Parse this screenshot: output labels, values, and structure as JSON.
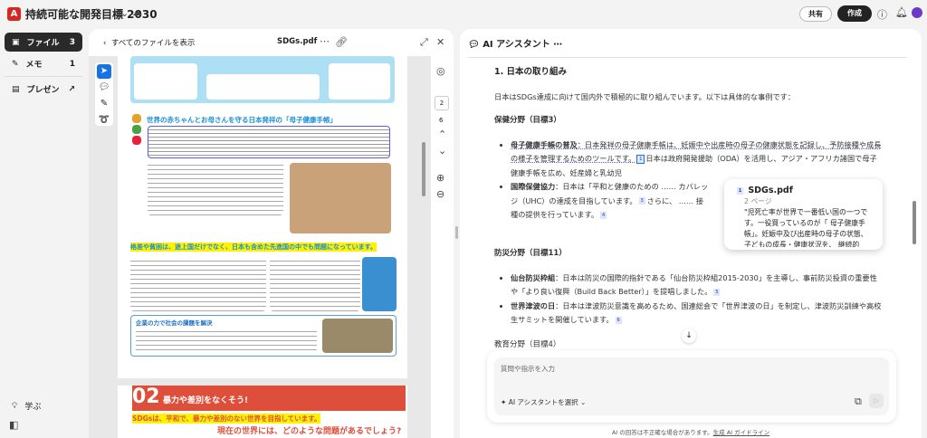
{
  "app": {
    "title": "持続可能な開発目標 2030",
    "share": "共有",
    "create": "作成"
  },
  "sidebar": {
    "items": [
      {
        "label": "ファイル",
        "count": "3"
      },
      {
        "label": "メモ",
        "count": "1"
      },
      {
        "label": "プレゼン"
      }
    ],
    "learn": "学ぶ"
  },
  "pdf": {
    "back": "すべてのファイルを表示",
    "filename": "SDGs.pdf",
    "page_current": "2",
    "page_total": "6",
    "page_content": {
      "heading1": "世界の赤ちゃんとお母さんを守る日本発祥の「母子健康手帳」",
      "heading2": "格差や貧困は、途上国だけでなく、日本も含めた先進国の中でも問題になっています。",
      "heading3": "企業の力で社会の課題を解決",
      "section_number": "02",
      "section_title": "暴力や差別をなくそう!",
      "tagline": "SDGsは、平和で、暴力や差別のない世界を目指しています。",
      "subline": "現在の世界には、どのような問題があるでしょう?"
    }
  },
  "ai": {
    "title": "AI アシスタント",
    "h3": "1. 日本の取り組み",
    "intro": "日本はSDGs達成に向けて国内外で積極的に取り組んでいます。以下は具体的な事例です：",
    "sections": [
      {
        "heading": "保健分野（目標3）",
        "items": [
          {
            "term": "母子健康手帳の普及",
            "text": "：日本発祥の母子健康手帳は、妊娠中や出産時の母子の健康状態を記録し、予防接種や成長の様子を管理するためのツールです。",
            "cite": "1",
            "text2": "日本は政府開発援助（ODA）を活用し、アジア・アフリカ諸国で母子健康手帳を広め、妊産婦と乳幼児"
          },
          {
            "term": "国際保健協力",
            "text": "：日本は「平和と健康のための",
            "text_b": "カバレッジ（UHC）の達成を目指しています。",
            "cite": "3",
            "text2": "さらに、",
            "text3": "接種の提供を行っています。",
            "cite2": "4"
          }
        ]
      },
      {
        "heading": "防災分野（目標11）",
        "items": [
          {
            "term": "仙台防災枠組",
            "text": "：日本は防災の国際的指針である「仙台防災枠組2015-2030」を主導し、事前防災投資の重要性や「より良い復興（Build Back Better）」を提唱しました。",
            "cite": "5"
          },
          {
            "term": "世界津波の日",
            "text": "：日本は津波防災意識を高めるため、国連総会で「世界津波の日」を制定し、津波防災訓練や高校生サミットを開催しています。",
            "cite": "6"
          }
        ]
      },
      {
        "heading": "教育分野（目標4）"
      }
    ],
    "popover": {
      "file": "SDGs.pdf",
      "page": "2 ページ",
      "excerpt": "\"児死亡率が世界で一番低い国の一つです。一役買っているのが「 母子健康手帳」。妊娠中及び出産時の母子の状態、子どもの成長・健康状況を、 継続的に…"
    },
    "input_placeholder": "質問や指示を入力",
    "select_assistant": "AI アシスタントを選択",
    "disclaimer": "AI の回答は不正確な場合があります。",
    "guideline_link": "生成 AI ガイドライン"
  },
  "colors": {
    "accent": "#1473e6",
    "brand": "#d7261e",
    "highlight": "#fff200"
  }
}
